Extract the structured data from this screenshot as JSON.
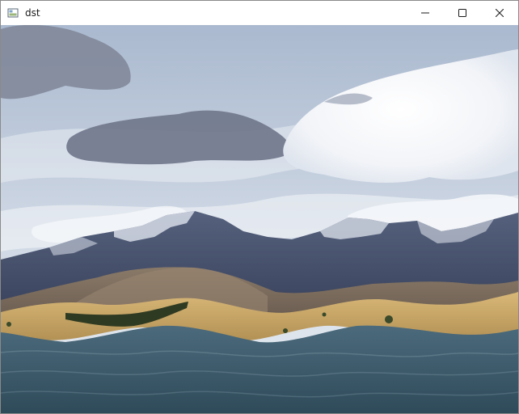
{
  "window": {
    "title": "dst",
    "controls": [
      "minimize",
      "maximize",
      "close"
    ]
  },
  "image": {
    "scene": "mountain-landscape-with-wavy-distortion",
    "colors": {
      "sky_top": "#aebfd6",
      "sky_bottom": "#e6ecf2",
      "mountain": "#4a5672",
      "snow": "#dfe4ee",
      "grass": "#c9a868",
      "water": "#3f5a6b"
    }
  }
}
